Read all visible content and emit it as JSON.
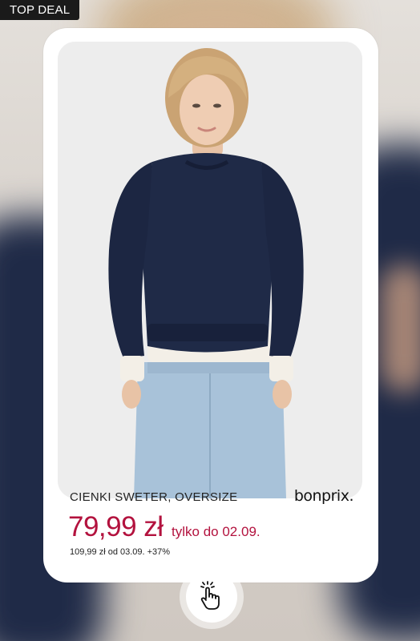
{
  "badge": {
    "label": "TOP DEAL"
  },
  "product": {
    "title": "CIENKI SWETER, OVERSIZE",
    "brand": "bonprix.",
    "price": "79,99 zł",
    "promo": "tylko do 02.09.",
    "old_price_note": "109,99 zł od 03.09. +37%",
    "image_icon": "product-photo-woman-navy-sweater-jeans"
  },
  "tap_button": {
    "icon": "hand-tap-icon"
  },
  "colors": {
    "accent_price": "#b3123e",
    "badge_bg": "#1a1a1a",
    "sweater": "#1f2a47"
  }
}
